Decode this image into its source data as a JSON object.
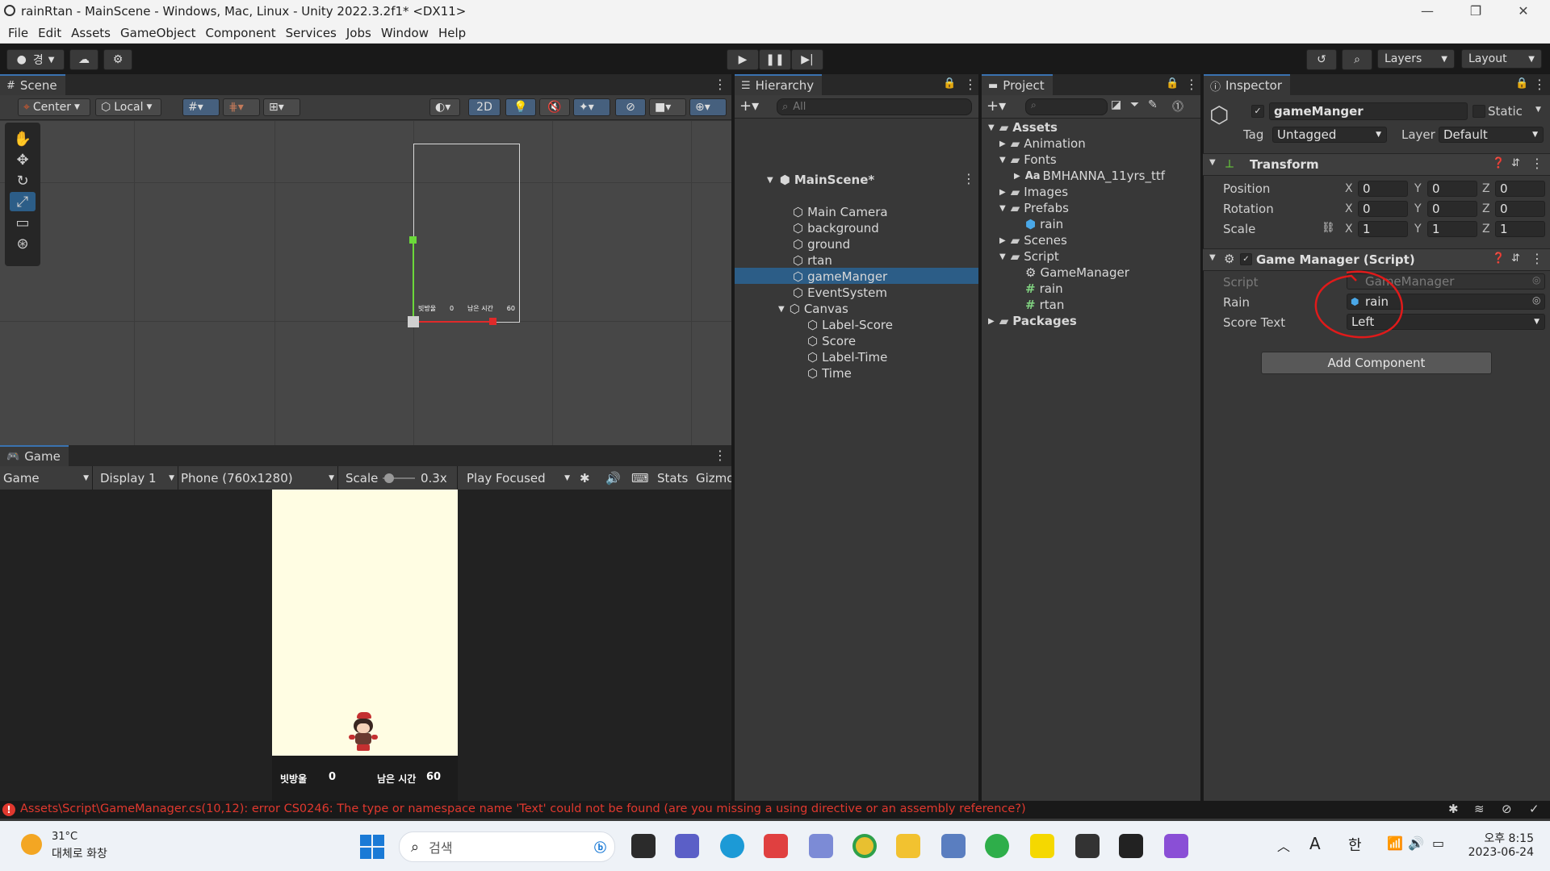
{
  "window": {
    "title": "rainRtan - MainScene - Windows, Mac, Linux - Unity 2022.3.2f1* <DX11>"
  },
  "menu": [
    "File",
    "Edit",
    "Assets",
    "GameObject",
    "Component",
    "Services",
    "Jobs",
    "Window",
    "Help"
  ],
  "toolbar": {
    "account_label": "경",
    "layers_label": "Layers",
    "layout_label": "Layout"
  },
  "scene": {
    "tab": "Scene",
    "pivot_label": "Center",
    "space_label": "Local",
    "mode_2d": "2D",
    "ui_left_label": "빗방울",
    "ui_left_value": "0",
    "ui_right_label": "남은 시간",
    "ui_right_value": "60"
  },
  "game": {
    "tab": "Game",
    "mode": "Game",
    "display": "Display 1",
    "resolution": "Phone (760x1280)",
    "scale_label": "Scale",
    "scale_value": "0.3x",
    "play_focus": "Play Focused",
    "stats": "Stats",
    "gizmos": "Gizmo",
    "score_label": "빗방울",
    "score_value": "0",
    "time_label": "남은 시간",
    "time_value": "60"
  },
  "hierarchy": {
    "tab": "Hierarchy",
    "search_placeholder": "All",
    "items": [
      {
        "label": "MainScene*"
      },
      {
        "label": "Main Camera"
      },
      {
        "label": "background"
      },
      {
        "label": "ground"
      },
      {
        "label": "rtan"
      },
      {
        "label": "gameManger",
        "selected": true
      },
      {
        "label": "EventSystem"
      },
      {
        "label": "Canvas"
      },
      {
        "label": "Label-Score"
      },
      {
        "label": "Score"
      },
      {
        "label": "Label-Time"
      },
      {
        "label": "Time"
      }
    ]
  },
  "project": {
    "tab": "Project",
    "items": [
      {
        "label": "Assets",
        "icon": "folder-icon"
      },
      {
        "label": "Animation",
        "icon": "folder-icon"
      },
      {
        "label": "Fonts",
        "icon": "folder-icon"
      },
      {
        "label": "BMHANNA_11yrs_ttf",
        "icon": "font-icon",
        "prefix": "Aa"
      },
      {
        "label": "Images",
        "icon": "folder-icon"
      },
      {
        "label": "Prefabs",
        "icon": "folder-icon"
      },
      {
        "label": "rain",
        "icon": "prefab-icon"
      },
      {
        "label": "Scenes",
        "icon": "folder-icon"
      },
      {
        "label": "Script",
        "icon": "folder-icon"
      },
      {
        "label": "GameManager",
        "icon": "gear-icon"
      },
      {
        "label": "rain",
        "icon": "script-icon"
      },
      {
        "label": "rtan",
        "icon": "script-icon"
      },
      {
        "label": "Packages",
        "icon": "folder-icon"
      }
    ]
  },
  "inspector": {
    "tab": "Inspector",
    "object_name": "gameManger",
    "static_label": "Static",
    "tag_label": "Tag",
    "tag_value": "Untagged",
    "layer_label": "Layer",
    "layer_value": "Default",
    "transform": {
      "title": "Transform",
      "position_label": "Position",
      "rotation_label": "Rotation",
      "scale_label": "Scale",
      "position": {
        "x": "0",
        "y": "0",
        "z": "0"
      },
      "rotation": {
        "x": "0",
        "y": "0",
        "z": "0"
      },
      "scale": {
        "x": "1",
        "y": "1",
        "z": "1"
      },
      "axis": {
        "x": "X",
        "y": "Y",
        "z": "Z"
      }
    },
    "game_manager": {
      "title": "Game Manager (Script)",
      "script_label": "Script",
      "script_value": "GameManager",
      "rain_label": "Rain",
      "rain_value": "rain",
      "score_text_label": "Score Text",
      "score_text_value": "Left"
    },
    "add_component": "Add Component"
  },
  "status": {
    "error": "Assets\\Script\\GameManager.cs(10,12): error CS0246: The type or namespace name 'Text' could not be found (are you missing a using directive or an assembly reference?)",
    "error_color": "#e0382e"
  },
  "taskbar": {
    "weather_temp": "31°C",
    "weather_desc": "대체로 화창",
    "search_placeholder": "검색",
    "ime_a": "A",
    "ime_han": "한",
    "time": "오후 8:15",
    "date": "2023-06-24"
  },
  "colors": {
    "selection": "#2c5d87",
    "accent": "#3a72b0",
    "annotation": "#e01a1a"
  }
}
